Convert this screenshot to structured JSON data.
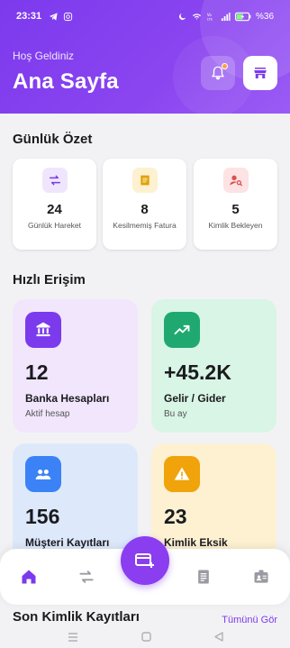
{
  "status_bar": {
    "time": "23:31",
    "battery": "%36",
    "icons": [
      "telegram-icon",
      "instagram-icon",
      "moon-icon",
      "wifi-icon",
      "volte-icon",
      "signal-icon",
      "battery-charging-icon"
    ]
  },
  "header": {
    "greeting": "Hoş Geldiniz",
    "title": "Ana Sayfa",
    "notification_icon": "bell-icon",
    "store_icon": "storefront-icon",
    "colors": {
      "gradient_start": "#7c3aed",
      "gradient_end": "#9a5cf5"
    }
  },
  "daily_summary": {
    "title": "Günlük Özet",
    "items": [
      {
        "value": "24",
        "label": "Günlük Hareket",
        "icon": "swap-icon",
        "color": "#7c3aed",
        "bg": "#efe6fd"
      },
      {
        "value": "8",
        "label": "Kesilmemiş Fatura",
        "icon": "receipt-icon",
        "color": "#e0a100",
        "bg": "#fdf1d2"
      },
      {
        "value": "5",
        "label": "Kimlik Bekleyen",
        "icon": "person-search-icon",
        "color": "#d9534f",
        "bg": "#fde3e3"
      }
    ]
  },
  "quick_access": {
    "title": "Hızlı Erişim",
    "cards": [
      {
        "value": "12",
        "label": "Banka Hesapları",
        "sub": "Aktif hesap",
        "icon": "bank-icon",
        "icon_bg": "#7c3aed",
        "bg": "#f1e6fc"
      },
      {
        "value": "+45.2K",
        "label": "Gelir / Gider",
        "sub": "Bu ay",
        "icon": "trending-up-icon",
        "icon_bg": "#1fa971",
        "bg": "#d8f5e6"
      },
      {
        "value": "156",
        "label": "Müşteri Kayıtları",
        "sub": "",
        "icon": "people-icon",
        "icon_bg": "#3b82f6",
        "bg": "#dde9fb"
      },
      {
        "value": "23",
        "label": "Kimlik Eksik",
        "sub": "",
        "icon": "warning-icon",
        "icon_bg": "#f0a30a",
        "bg": "#fdf1d2"
      }
    ]
  },
  "recent_ids": {
    "title": "Son Kimlik Kayıtları",
    "see_all": "Tümünü Gör"
  },
  "bottom_nav": {
    "items": [
      "home-icon",
      "swap-icon",
      "add-invoice-icon",
      "document-icon",
      "id-badge-icon"
    ],
    "active": "home-icon"
  }
}
